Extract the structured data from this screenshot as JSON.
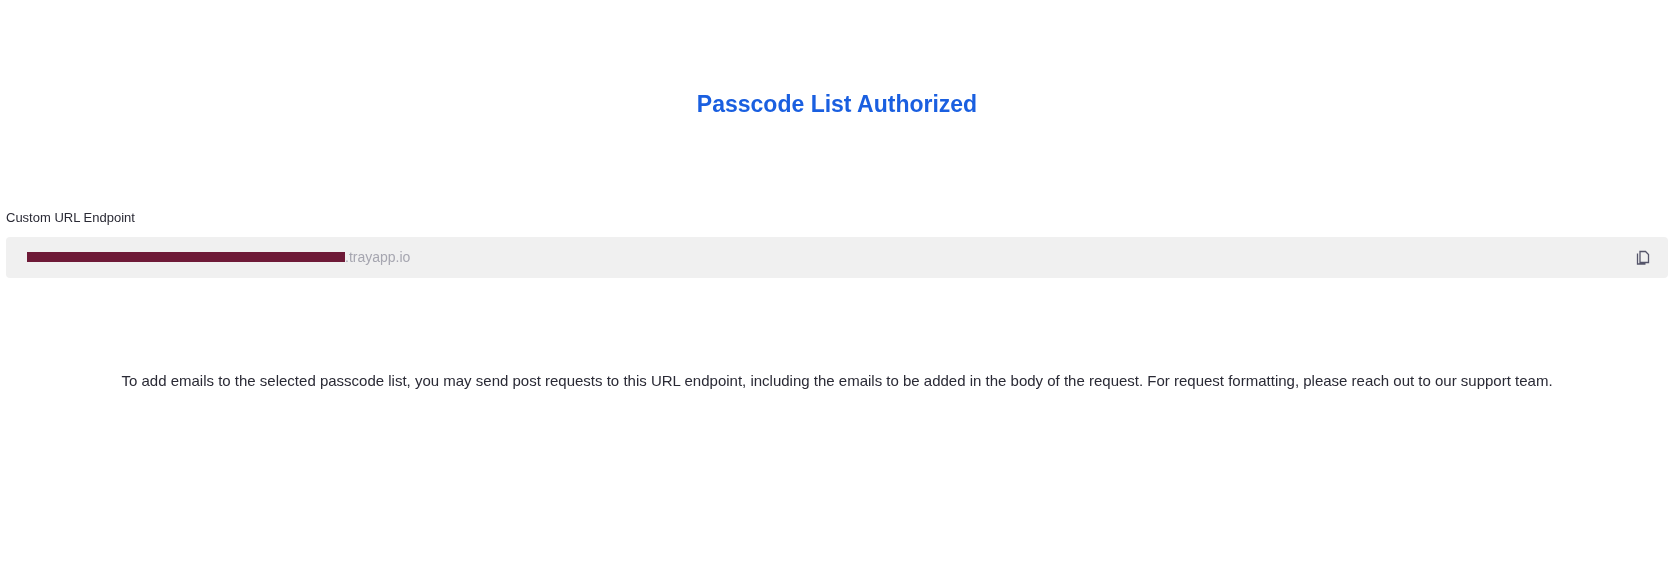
{
  "title": "Passcode List Authorized",
  "endpoint": {
    "label": "Custom URL Endpoint",
    "value": ".trayapp.io",
    "redacted": true
  },
  "description": "To add emails to the selected passcode list, you may send post requests to this URL endpoint, including the emails to be added in the body of the request. For request formatting, please reach out to our support team."
}
